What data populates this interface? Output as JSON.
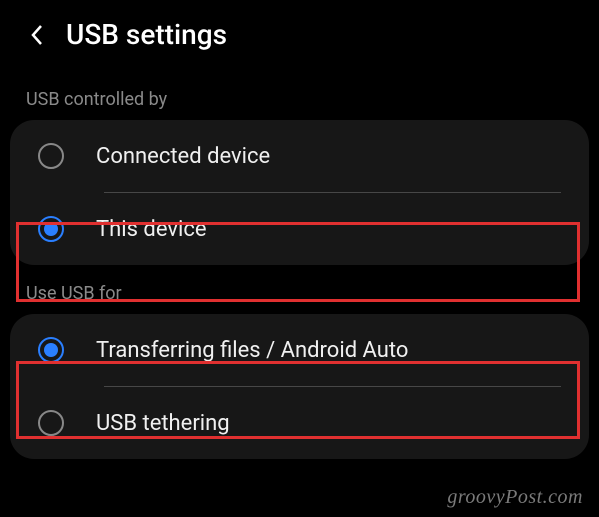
{
  "header": {
    "title": "USB settings"
  },
  "sections": {
    "controlled_by": {
      "label": "USB controlled by",
      "options": {
        "connected": "Connected device",
        "this_device": "This device"
      }
    },
    "use_for": {
      "label": "Use USB for",
      "options": {
        "transferring": "Transferring files / Android Auto",
        "tethering": "USB tethering"
      }
    }
  },
  "watermark": "groovyPost.com"
}
